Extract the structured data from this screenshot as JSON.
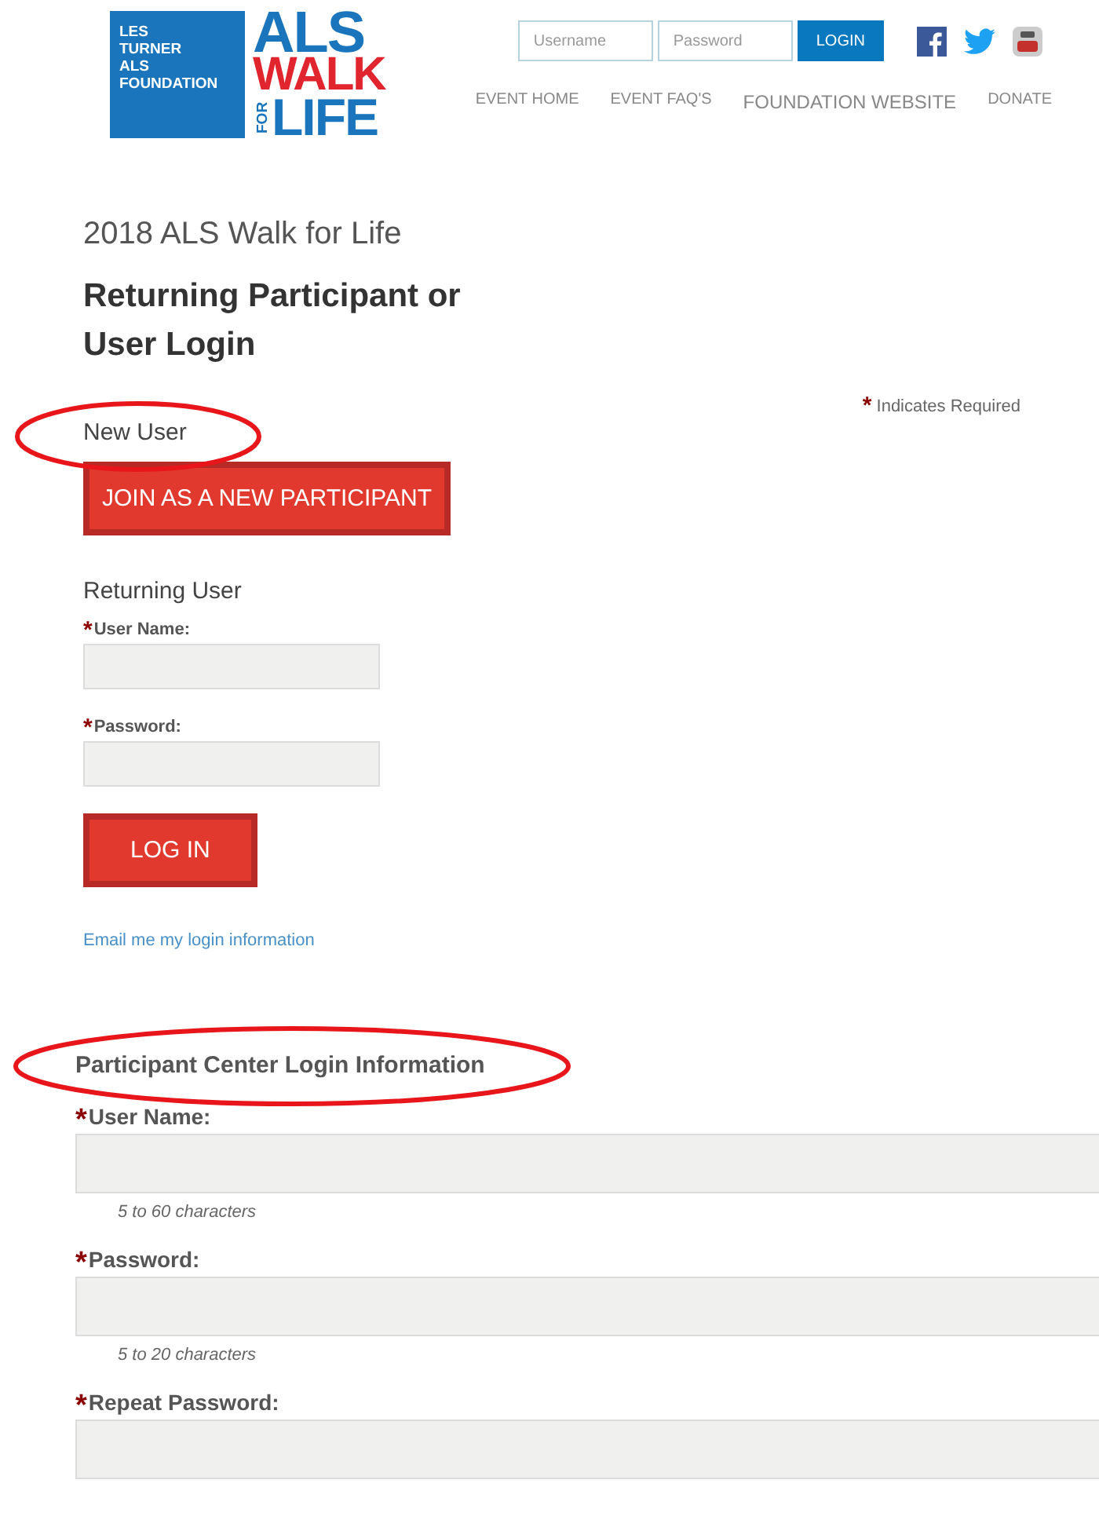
{
  "header": {
    "logo": {
      "foundation_lines": [
        "LES",
        "TURNER",
        "ALS",
        "FOUNDATION"
      ],
      "words": [
        "ALS",
        "WALK",
        "FOR",
        "LIFE"
      ]
    },
    "login": {
      "username_placeholder": "Username",
      "password_placeholder": "Password",
      "button": "LOGIN"
    },
    "nav": [
      "EVENT HOME",
      "EVENT FAQ'S",
      "FOUNDATION WEBSITE",
      "DONATE"
    ]
  },
  "page_title": "2018 ALS Walk for Life",
  "heading": "Returning Participant or User Login",
  "required_note": {
    "mark": "*",
    "text": "Indicates Required"
  },
  "new_user": {
    "label": "New User",
    "circled": true,
    "button": "JOIN AS A NEW PARTICIPANT"
  },
  "returning_user": {
    "label": "Returning User",
    "fields": [
      {
        "mark": "*",
        "label": "User Name:"
      },
      {
        "mark": "*",
        "label": "Password:"
      }
    ],
    "button": "LOG IN",
    "link": "Email me my login information"
  },
  "participant_center": {
    "heading": "Participant Center Login Information",
    "circled": true,
    "fields": [
      {
        "mark": "*",
        "label": "User Name:",
        "hint": "5 to 60 characters"
      },
      {
        "mark": "*",
        "label": "Password:",
        "hint": "5 to 20 characters"
      },
      {
        "mark": "*",
        "label": "Repeat Password:"
      }
    ]
  }
}
